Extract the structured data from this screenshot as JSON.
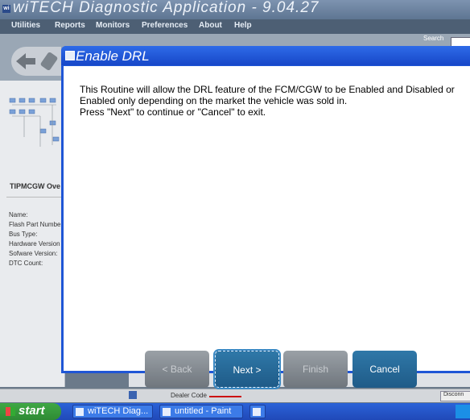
{
  "app": {
    "title": "wiTECH Diagnostic Application - 9.04.27",
    "icon": "wi"
  },
  "menu": [
    "Utilities",
    "Reports",
    "Monitors",
    "Preferences",
    "About",
    "Help"
  ],
  "toolbar": {
    "search_label": "Search"
  },
  "left_panel": {
    "module_title": "TIPMCGW Ove",
    "fields": [
      "Name:",
      "Flash Part Numbe",
      "Bus Type:",
      "Hardware Version",
      "Sofware Version:",
      "DTC Count:"
    ]
  },
  "status_bar": {
    "dealer_label": "Dealer Code",
    "disconnect_label": "Disconn"
  },
  "dialog": {
    "title": "Enable DRL",
    "message_lines": [
      "This Routine will allow the DRL feature of the FCM/CGW to be Enabled and Disabled or",
      "Enabled only depending on the market the vehicle was sold in.",
      "Press \"Next\" to continue or \"Cancel\" to exit."
    ],
    "buttons": {
      "back": "< Back",
      "next": "Next >",
      "finish": "Finish",
      "cancel": "Cancel"
    }
  },
  "taskbar": {
    "start_label": "start",
    "tasks": [
      "wiTECH Diag...",
      "untitled - Paint"
    ]
  }
}
